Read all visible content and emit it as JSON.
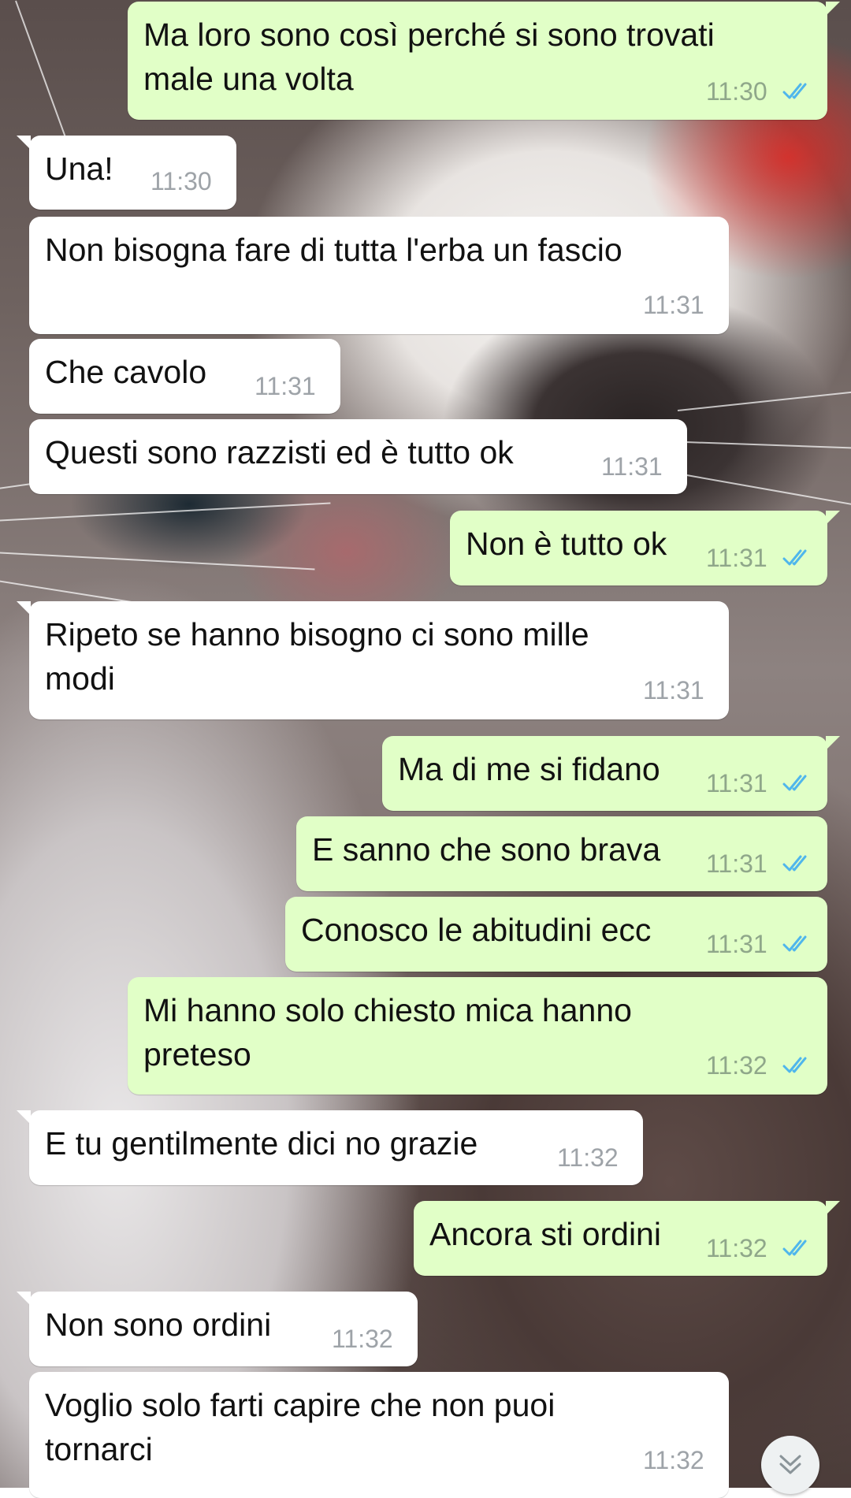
{
  "chat": {
    "messages": [
      {
        "dir": "out",
        "text": "Ma loro sono così perché si sono trovati\nmale una volta",
        "time": "11:30",
        "read": true
      },
      {
        "dir": "in",
        "text": "Una!",
        "time": "11:30"
      },
      {
        "dir": "in",
        "text": "Non bisogna fare di tutta l'erba un fascio",
        "time": "11:31"
      },
      {
        "dir": "in",
        "text": "Che cavolo",
        "time": "11:31"
      },
      {
        "dir": "in",
        "text": "Questi sono razzisti ed è tutto ok",
        "time": "11:31"
      },
      {
        "dir": "out",
        "text": "Non è tutto ok",
        "time": "11:31",
        "read": true
      },
      {
        "dir": "in",
        "text": "Ripeto se hanno bisogno ci sono mille\nmodi",
        "time": "11:31"
      },
      {
        "dir": "out",
        "text": "Ma di me si fidano",
        "time": "11:31",
        "read": true
      },
      {
        "dir": "out",
        "text": "E sanno che sono brava",
        "time": "11:31",
        "read": true
      },
      {
        "dir": "out",
        "text": "Conosco le abitudini ecc",
        "time": "11:31",
        "read": true
      },
      {
        "dir": "out",
        "text": "Mi hanno solo chiesto mica hanno\npreteso",
        "time": "11:32",
        "read": true
      },
      {
        "dir": "in",
        "text": "E tu gentilmente dici no grazie",
        "time": "11:32"
      },
      {
        "dir": "out",
        "text": "Ancora sti ordini",
        "time": "11:32",
        "read": true
      },
      {
        "dir": "in",
        "text": "Non sono ordini",
        "time": "11:32"
      },
      {
        "dir": "in",
        "text": "Voglio solo farti capire che non puoi\ntornarci",
        "time": "11:32"
      }
    ]
  },
  "icons": {
    "read_receipt": "double-check-icon",
    "scroll_down": "chevron-double-down-icon"
  },
  "colors": {
    "incoming_bubble": "#ffffff",
    "outgoing_bubble": "#e1ffc7",
    "timestamp": "#9ea3a8",
    "read_tick": "#4fb6ec"
  }
}
